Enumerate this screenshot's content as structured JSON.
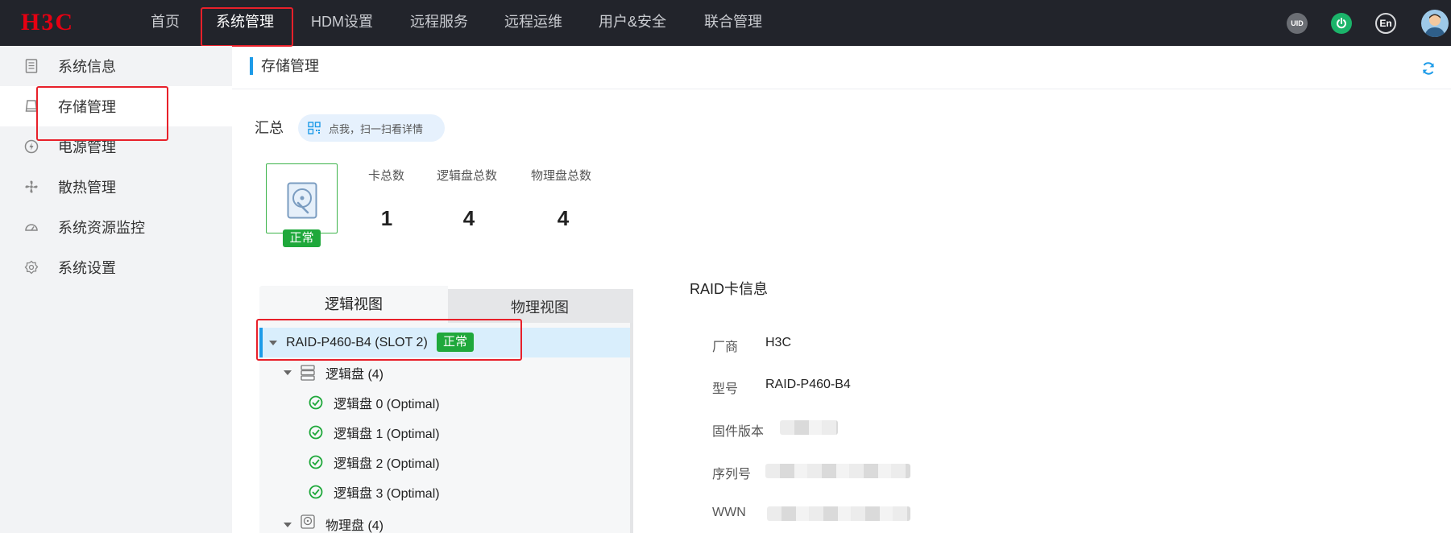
{
  "header": {
    "logo": "H3C",
    "nav": [
      {
        "label": "首页"
      },
      {
        "label": "系统管理"
      },
      {
        "label": "HDM设置"
      },
      {
        "label": "远程服务"
      },
      {
        "label": "远程运维"
      },
      {
        "label": "用户&安全"
      },
      {
        "label": "联合管理"
      }
    ],
    "uid_label": "UID",
    "lang_label": "En"
  },
  "sidebar": {
    "items": [
      {
        "label": "系统信息",
        "icon": "document-icon"
      },
      {
        "label": "存储管理",
        "icon": "drive-icon"
      },
      {
        "label": "电源管理",
        "icon": "power-icon"
      },
      {
        "label": "散热管理",
        "icon": "fan-icon"
      },
      {
        "label": "系统资源监控",
        "icon": "gauge-icon"
      },
      {
        "label": "系统设置",
        "icon": "gear-icon"
      }
    ]
  },
  "page": {
    "title": "存储管理",
    "summary_label": "汇总",
    "scan_text": "点我，扫一扫看详情",
    "status": "正常",
    "stats": [
      {
        "label": "卡总数",
        "value": "1"
      },
      {
        "label": "逻辑盘总数",
        "value": "4"
      },
      {
        "label": "物理盘总数",
        "value": "4"
      }
    ]
  },
  "tabs": [
    {
      "label": "逻辑视图"
    },
    {
      "label": "物理视图"
    }
  ],
  "tree": {
    "controller": {
      "label": "RAID-P460-B4 (SLOT 2)",
      "status": "正常"
    },
    "logical_group": {
      "label": "逻辑盘 (4)"
    },
    "logical_disks": [
      {
        "label": "逻辑盘 0 (Optimal)"
      },
      {
        "label": "逻辑盘 1 (Optimal)"
      },
      {
        "label": "逻辑盘 2 (Optimal)"
      },
      {
        "label": "逻辑盘 3 (Optimal)"
      }
    ],
    "physical_group": {
      "label": "物理盘 (4)"
    }
  },
  "raid_info": {
    "title": "RAID卡信息",
    "fields": [
      {
        "label": "厂商",
        "value": "H3C"
      },
      {
        "label": "型号",
        "value": "RAID-P460-B4"
      },
      {
        "label": "固件版本",
        "value": ""
      },
      {
        "label": "序列号",
        "value": ""
      },
      {
        "label": "WWN",
        "value": ""
      }
    ]
  },
  "colors": {
    "topbar": "#22242b",
    "accent": "#1d9be8",
    "status_green": "#1fa83b",
    "highlight_red": "#e8202a",
    "logo_red": "#e60012"
  }
}
